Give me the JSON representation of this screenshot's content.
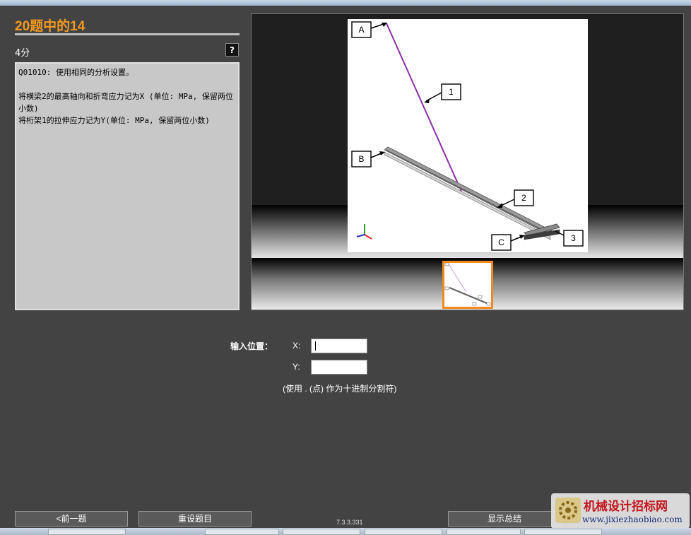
{
  "header": {
    "title": "20题中的14",
    "points": "4分",
    "help_label": "?"
  },
  "question": {
    "paragraphs": [
      "Q01010: 使用相同的分析设置。",
      "将横梁2的最高轴向和折弯应力记为X (单位: MPa, 保留两位小数)\n将桁架1的拉伸应力记为Y(单位: MPa, 保留两位小数)"
    ]
  },
  "figure": {
    "labels": {
      "A": "A",
      "B": "B",
      "C": "C",
      "n1": "1",
      "n2": "2",
      "n3": "3"
    },
    "colors": {
      "truss": "#8b2fa8",
      "beam": "#707070"
    }
  },
  "answer": {
    "input_label": "输入位置：",
    "x_label": "X:",
    "y_label": "Y:",
    "x_value": "",
    "y_value": "",
    "hint": "(使用 . (点) 作为十进制分割符)"
  },
  "footer": {
    "prev_label": "<前一题",
    "reset_label": "重设题目",
    "summary_label": "显示总结",
    "version": "7.3.3.331"
  },
  "watermark": {
    "name": "机械设计招标网",
    "url": "www.jixiezhaobiao.com"
  },
  "colors": {
    "accent": "#f39a20",
    "thumb_border": "#f08a1c"
  }
}
